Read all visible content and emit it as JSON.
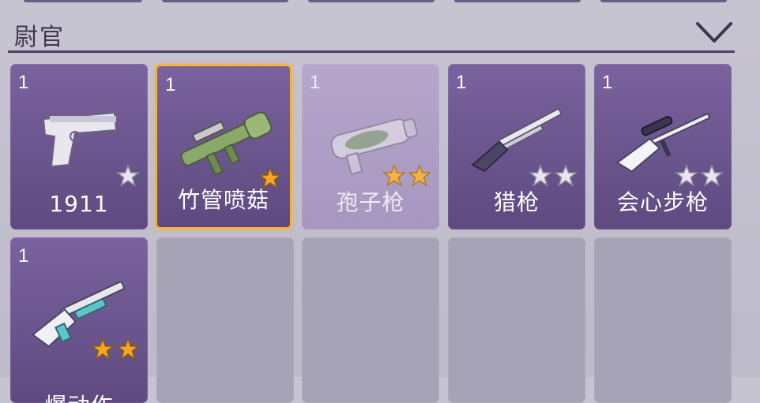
{
  "header": {
    "title": "尉官"
  },
  "colors": {
    "gold_star": "#f6a623",
    "silver_star": "#e6e6ee",
    "card": "#6b5590",
    "selected_border": "#f4b23a"
  },
  "weapons": [
    {
      "count": "1",
      "name": "1911",
      "stars": 1,
      "star_color": "silver",
      "icon": "pistol-icon",
      "state": "normal"
    },
    {
      "count": "1",
      "name": "竹管喷菇",
      "stars": 1,
      "star_color": "gold",
      "icon": "bamboo-launcher-icon",
      "state": "selected"
    },
    {
      "count": "1",
      "name": "孢子枪",
      "stars": 2,
      "star_color": "gold",
      "icon": "spore-gun-icon",
      "state": "dim"
    },
    {
      "count": "1",
      "name": "猎枪",
      "stars": 2,
      "star_color": "silver",
      "icon": "hunting-shotgun-icon",
      "state": "normal"
    },
    {
      "count": "1",
      "name": "会心步枪",
      "stars": 2,
      "star_color": "silver",
      "icon": "sniper-rifle-icon",
      "state": "normal"
    },
    {
      "count": "1",
      "name": "爆动作",
      "stars": 2,
      "star_color": "gold",
      "icon": "pump-shotgun-icon",
      "state": "normal"
    }
  ]
}
